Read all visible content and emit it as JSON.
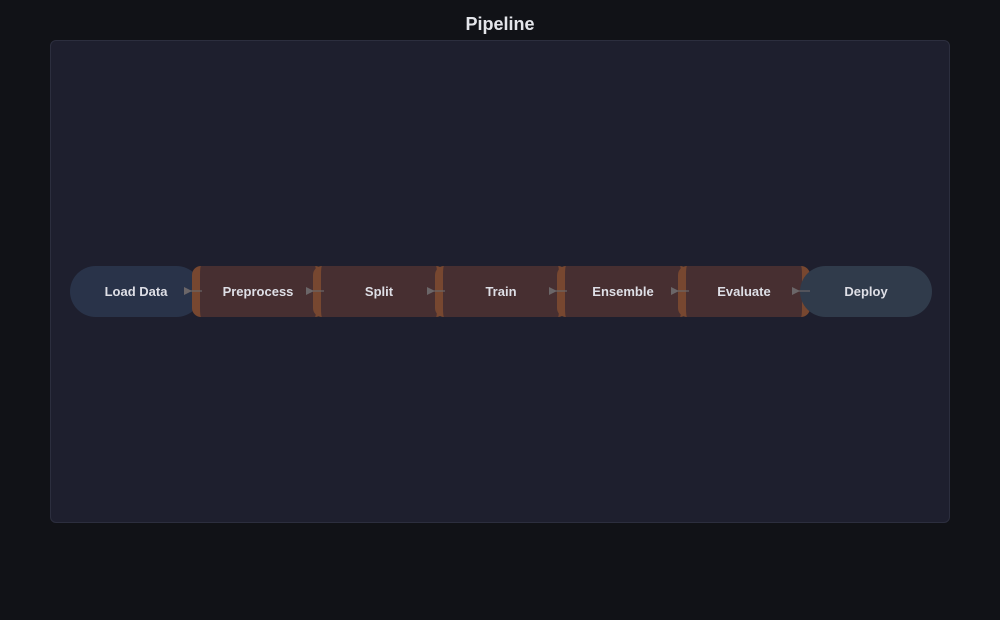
{
  "title": "Pipeline",
  "colors": {
    "page_bg": "#111217",
    "panel_bg": "#1e1f2e",
    "start_node": "#293349",
    "end_node": "#303b4b",
    "process_node": "#472f31",
    "process_edge": "#774730",
    "arrow": "#6b6668"
  },
  "nodes": [
    {
      "label": "Load Data",
      "kind": "start"
    },
    {
      "label": "Preprocess",
      "kind": "process"
    },
    {
      "label": "Split",
      "kind": "process"
    },
    {
      "label": "Train",
      "kind": "process"
    },
    {
      "label": "Ensemble",
      "kind": "process"
    },
    {
      "label": "Evaluate",
      "kind": "process"
    },
    {
      "label": "Deploy",
      "kind": "end"
    }
  ]
}
